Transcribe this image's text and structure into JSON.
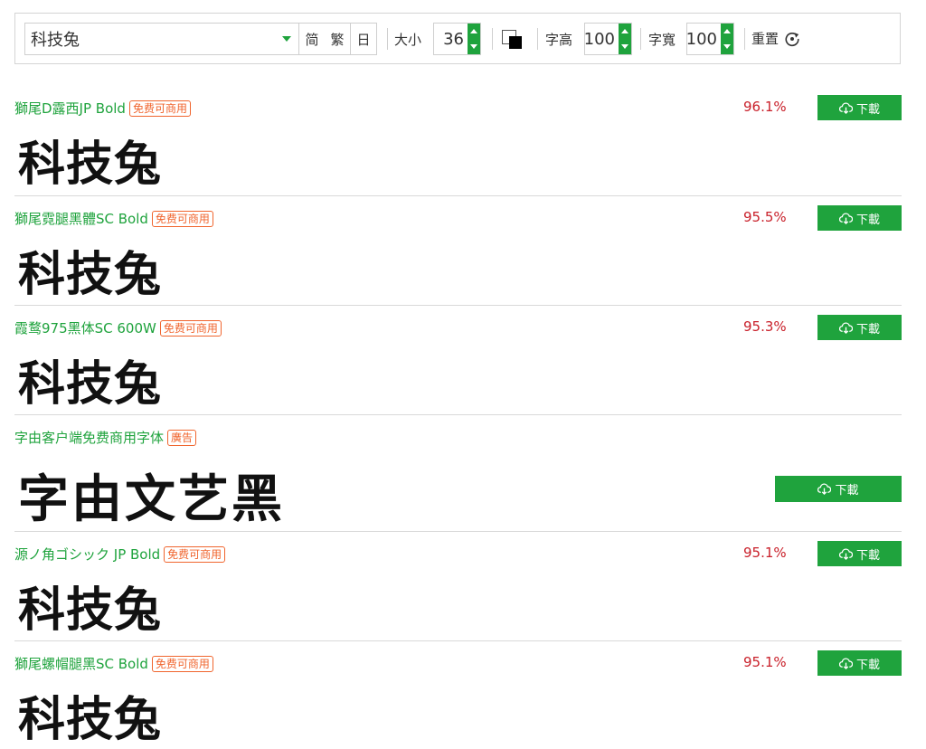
{
  "toolbar": {
    "text_value": "科技兔",
    "scripts": [
      "简",
      "繁",
      "日"
    ],
    "size_label": "大小",
    "size_value": "36",
    "height_label": "字高",
    "height_value": "100",
    "width_label": "字寬",
    "width_value": "100",
    "reset_label": "重置",
    "colors": {
      "accent": "#1fa33d",
      "foreground": "#000000",
      "background": "#ffffff"
    }
  },
  "fonts": [
    {
      "name": "獅尾D露西JP Bold",
      "badge": "免费可商用",
      "match": "96.1%",
      "download": "下載",
      "preview": "科技兔"
    },
    {
      "name": "獅尾霓腿黑體SC Bold",
      "badge": "免费可商用",
      "match": "95.5%",
      "download": "下載",
      "preview": "科技兔"
    },
    {
      "name": "霞鹜975黑体SC 600W",
      "badge": "免费可商用",
      "match": "95.3%",
      "download": "下載",
      "preview": "科技兔"
    },
    {
      "name": "字由客户端免费商用字体",
      "badge": "廣告",
      "match": "",
      "download": "下載",
      "preview": "字由文艺黑"
    },
    {
      "name": "源ノ角ゴシック JP Bold",
      "badge": "免费可商用",
      "match": "95.1%",
      "download": "下載",
      "preview": "科技兔"
    },
    {
      "name": "獅尾螺帽腿黑SC Bold",
      "badge": "免费可商用",
      "match": "95.1%",
      "download": "下載",
      "preview": "科技兔"
    }
  ]
}
